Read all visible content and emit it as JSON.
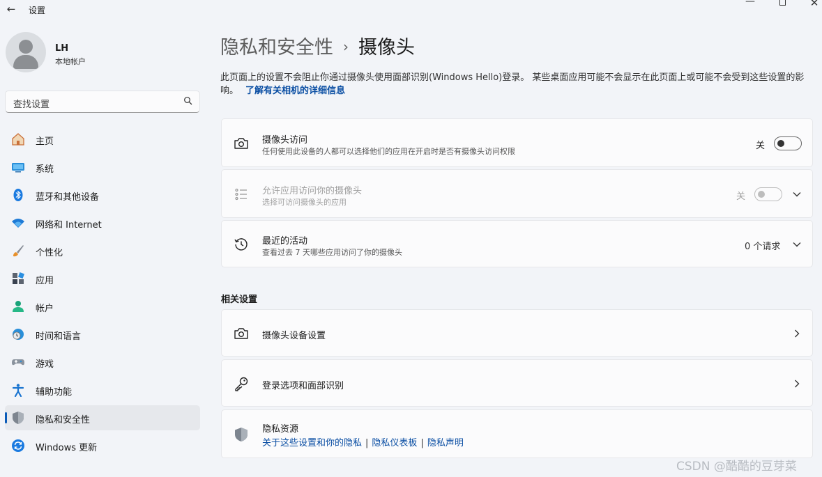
{
  "window": {
    "back_glyph": "←",
    "title": "设置",
    "minimize_glyph": "—",
    "close_glyph": "✕"
  },
  "user": {
    "name": "LH",
    "account_type": "本地帐户"
  },
  "search": {
    "placeholder": "查找设置"
  },
  "sidebar": {
    "items": [
      {
        "label": "主页",
        "icon": "home-icon"
      },
      {
        "label": "系统",
        "icon": "system-icon"
      },
      {
        "label": "蓝牙和其他设备",
        "icon": "bluetooth-icon"
      },
      {
        "label": "网络和 Internet",
        "icon": "wifi-icon"
      },
      {
        "label": "个性化",
        "icon": "brush-icon"
      },
      {
        "label": "应用",
        "icon": "apps-icon"
      },
      {
        "label": "帐户",
        "icon": "account-icon"
      },
      {
        "label": "时间和语言",
        "icon": "globe-clock-icon"
      },
      {
        "label": "游戏",
        "icon": "gamepad-icon"
      },
      {
        "label": "辅助功能",
        "icon": "accessibility-icon"
      },
      {
        "label": "隐私和安全性",
        "icon": "shield-icon",
        "active": true
      },
      {
        "label": "Windows 更新",
        "icon": "update-icon"
      }
    ]
  },
  "breadcrumb": {
    "parent": "隐私和安全性",
    "separator": "›",
    "current": "摄像头"
  },
  "description": {
    "text": "此页面上的设置不会阻止你通过摄像头使用面部识别(Windows Hello)登录。 某些桌面应用可能不会显示在此页面上或可能不会受到这些设置的影响。",
    "link": "了解有关相机的详细信息"
  },
  "settings": {
    "camera_access": {
      "title": "摄像头访问",
      "subtitle": "任何使用此设备的人都可以选择他们的应用在开启时是否有摄像头访问权限",
      "state_label": "关",
      "on": false
    },
    "app_access": {
      "title": "允许应用访问你的摄像头",
      "subtitle": "选择可访问摄像头的应用",
      "state_label": "关",
      "on": false,
      "disabled": true
    },
    "recent_activity": {
      "title": "最近的活动",
      "subtitle": "查看过去 7 天哪些应用访问了你的摄像头",
      "count": "0 个请求"
    }
  },
  "related": {
    "heading": "相关设置",
    "camera_device_settings": "摄像头设备设置",
    "sign_in_options": "登录选项和面部识别",
    "privacy_resources": {
      "title": "隐私资源",
      "links": [
        "关于这些设置和你的隐私",
        "隐私仪表板",
        "隐私声明"
      ],
      "separator": "|"
    }
  },
  "watermark": "CSDN @酷酷的豆芽菜",
  "colors": {
    "accent": "#0a5bb8",
    "link": "#0a4ea3",
    "background": "#f2f4f8",
    "card": "#fbfbfc"
  }
}
